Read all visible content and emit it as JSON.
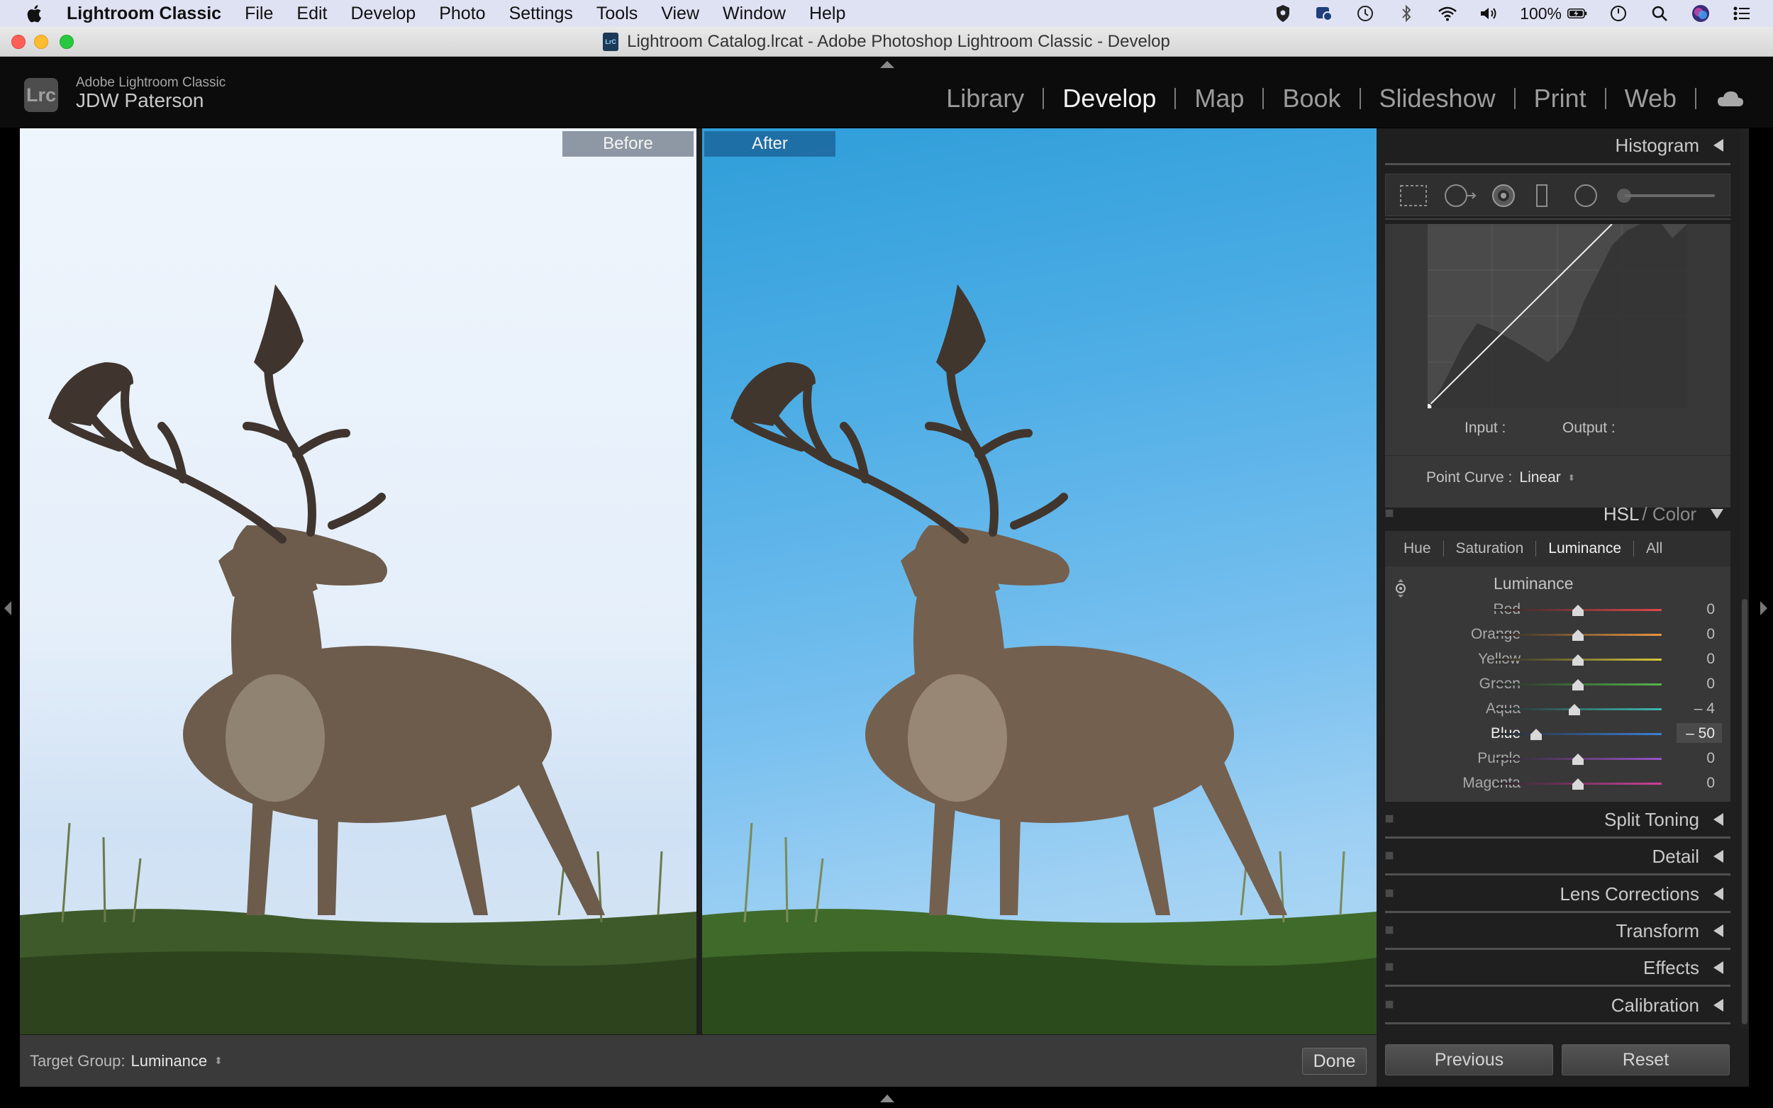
{
  "os_menubar": {
    "app_name": "Lightroom Classic",
    "menus": [
      "File",
      "Edit",
      "Develop",
      "Photo",
      "Settings",
      "Tools",
      "View",
      "Window",
      "Help"
    ],
    "battery": "100%"
  },
  "window": {
    "title": "Lightroom Catalog.lrcat - Adobe Photoshop Lightroom Classic - Develop",
    "doc_icon_text": "LrC"
  },
  "identity": {
    "logo": "Lrc",
    "product": "Adobe Lightroom Classic",
    "user": "JDW Paterson"
  },
  "modules": {
    "items": [
      "Library",
      "Develop",
      "Map",
      "Book",
      "Slideshow",
      "Print",
      "Web"
    ],
    "active": "Develop"
  },
  "view": {
    "before_label": "Before",
    "after_label": "After"
  },
  "toolbar": {
    "target_group_label": "Target Group:",
    "target_group_value": "Luminance",
    "done_label": "Done"
  },
  "right_panel": {
    "histogram_title": "Histogram",
    "tone_curve": {
      "input_label": "Input :",
      "output_label": "Output :",
      "point_curve_label": "Point Curve :",
      "point_curve_value": "Linear"
    },
    "hsl": {
      "title_primary": "HSL",
      "title_secondary": "/ Color",
      "tabs": [
        "Hue",
        "Saturation",
        "Luminance",
        "All"
      ],
      "active_tab": "Luminance",
      "section_title": "Luminance",
      "sliders": [
        {
          "name": "Red",
          "value": "0",
          "amount": 0,
          "color": "#e0464a"
        },
        {
          "name": "Orange",
          "value": "0",
          "amount": 0,
          "color": "#e89440"
        },
        {
          "name": "Yellow",
          "value": "0",
          "amount": 0,
          "color": "#d8c83c"
        },
        {
          "name": "Green",
          "value": "0",
          "amount": 0,
          "color": "#55b64a"
        },
        {
          "name": "Aqua",
          "value": "– 4",
          "amount": -4,
          "color": "#3fb8b0"
        },
        {
          "name": "Blue",
          "value": "– 50",
          "amount": -50,
          "color": "#3b7fd8"
        },
        {
          "name": "Purple",
          "value": "0",
          "amount": 0,
          "color": "#9a52c9"
        },
        {
          "name": "Magenta",
          "value": "0",
          "amount": 0,
          "color": "#cf3f9a"
        }
      ],
      "active_slider": "Blue"
    },
    "collapsed_panels": [
      "Split Toning",
      "Detail",
      "Lens Corrections",
      "Transform",
      "Effects",
      "Calibration"
    ],
    "previous_label": "Previous",
    "reset_label": "Reset"
  }
}
